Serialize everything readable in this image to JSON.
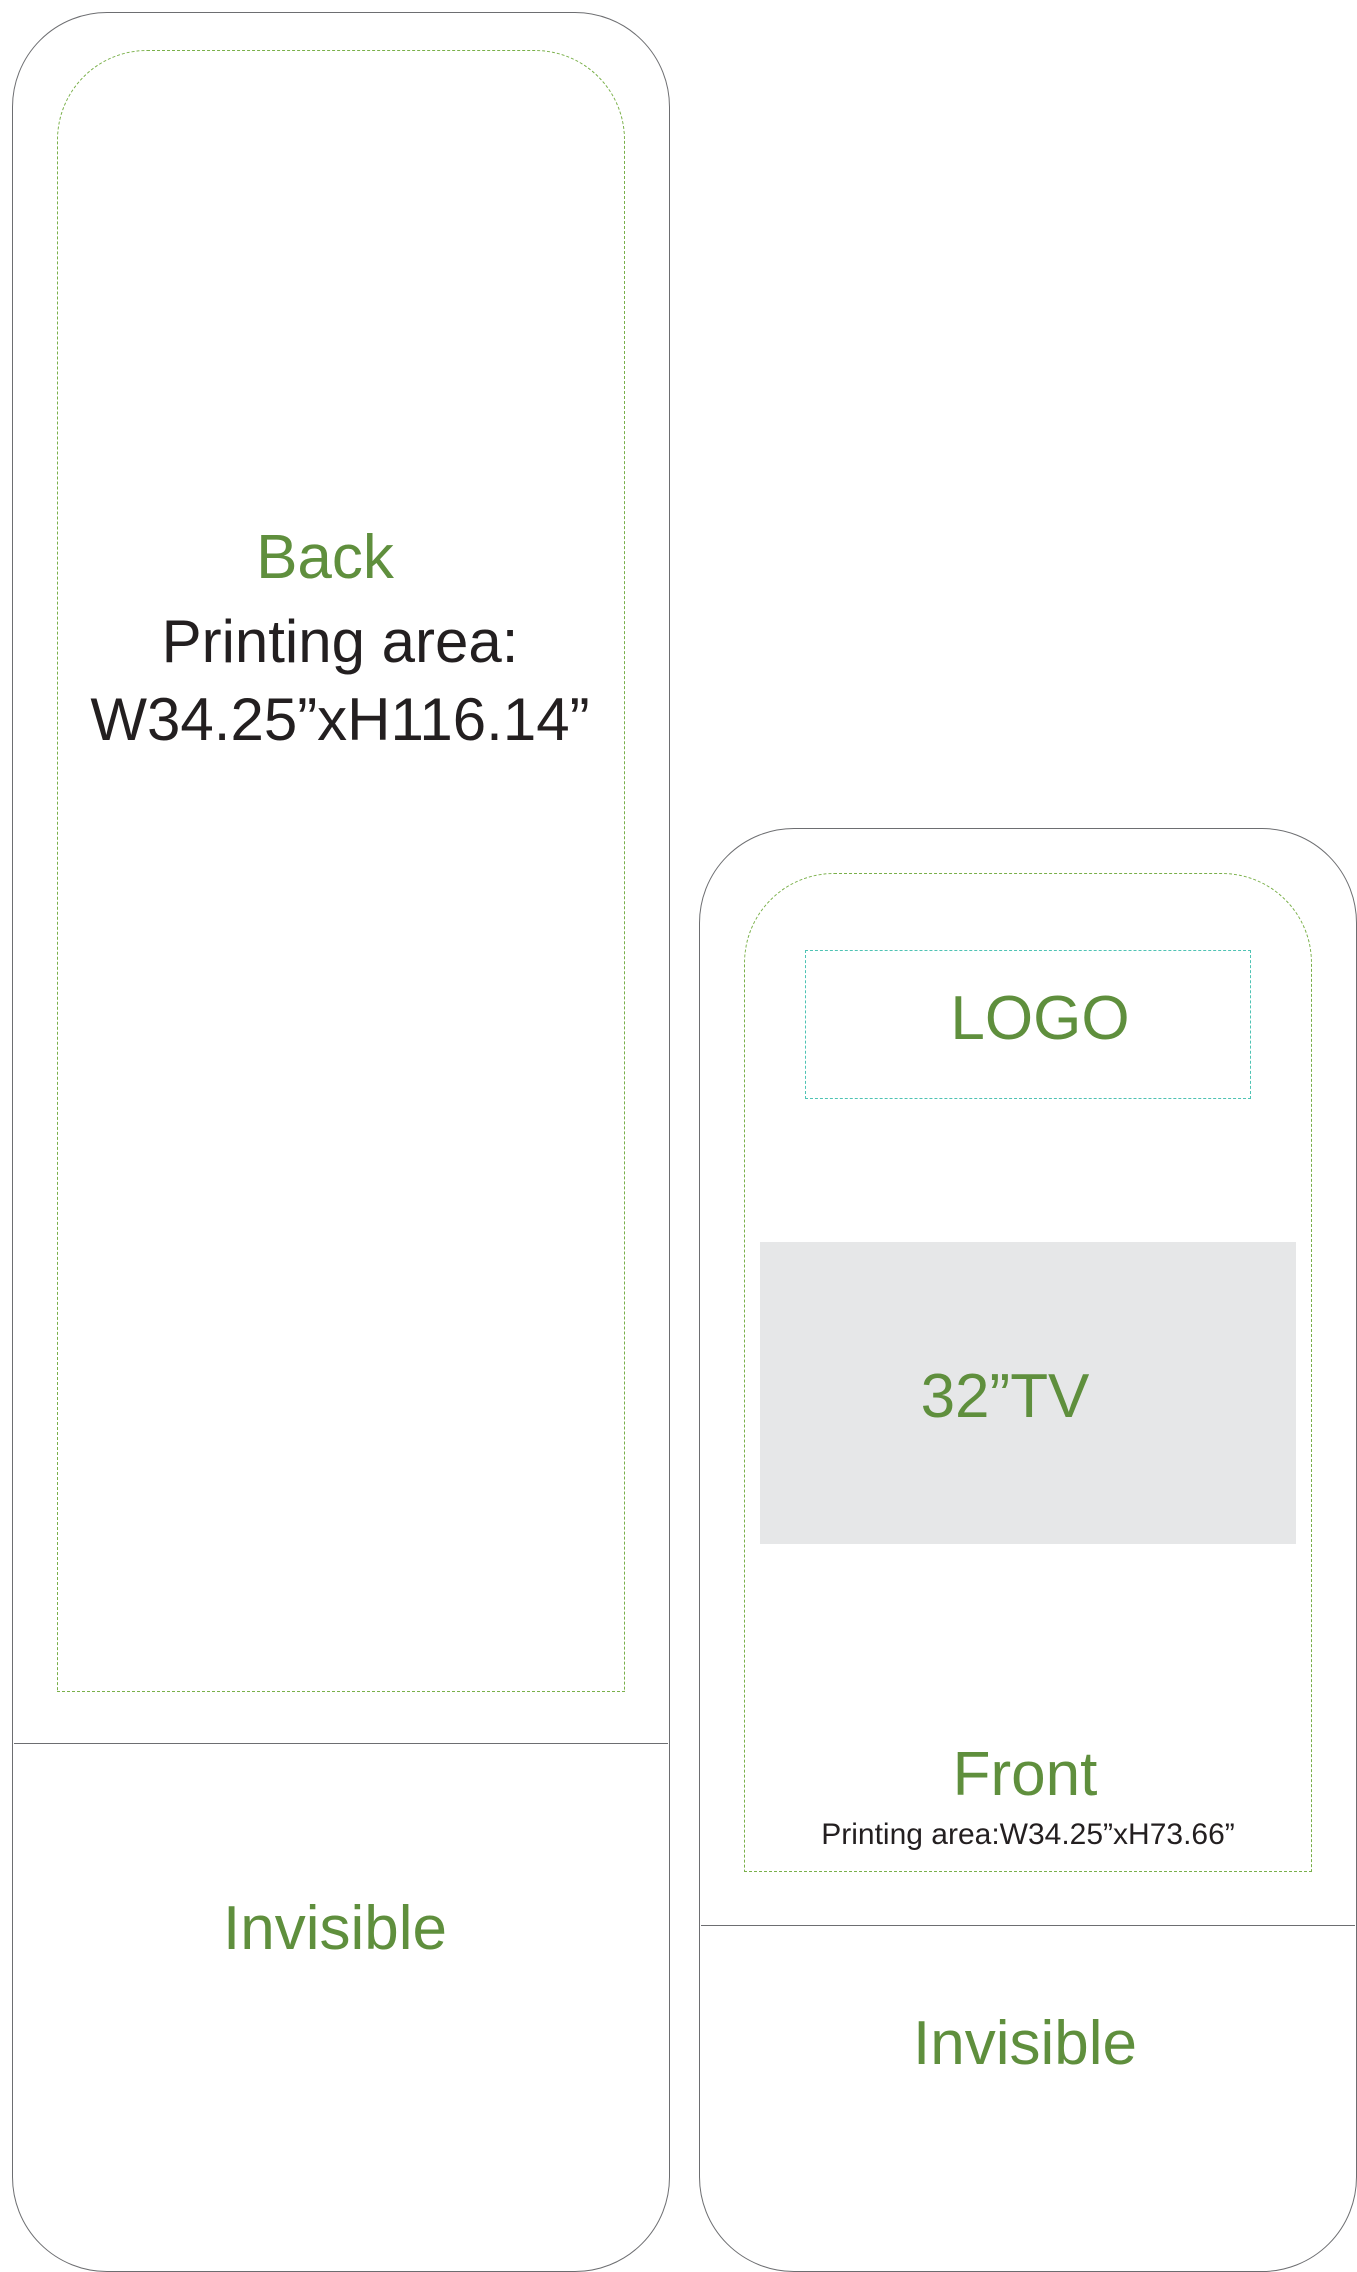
{
  "back": {
    "title": "Back",
    "printing_line1": "Printing area:",
    "printing_line2": "W34.25”xH116.14”",
    "invisible": "Invisible"
  },
  "front": {
    "logo": "LOGO",
    "tv": "32”TV",
    "title": "Front",
    "printing": "Printing area:W34.25”xH73.66”",
    "invisible": "Invisible"
  },
  "colors": {
    "label_green": "#5f8f3d",
    "text_dark": "#231f20",
    "outline": "#6d6e71",
    "safe_zone": "#7ab04a",
    "logo_zone": "#4fc3b4",
    "tv_fill": "#e6e7e8"
  }
}
